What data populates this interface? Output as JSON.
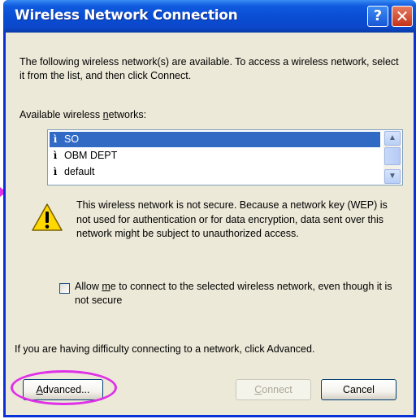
{
  "window": {
    "title": "Wireless Network Connection",
    "help_glyph": "?",
    "close_glyph": "✕"
  },
  "intro_text": "The following wireless network(s) are available. To access a wireless network, select it from the list, and then click Connect.",
  "available_label_pre": "Available wireless ",
  "available_label_mnemonic": "n",
  "available_label_post": "etworks:",
  "networks": [
    {
      "name": "SO",
      "selected": true
    },
    {
      "name": "OBM DEPT",
      "selected": false
    },
    {
      "name": "default",
      "selected": false
    }
  ],
  "network_icon_glyph": "ì",
  "scroll_up_glyph": "▲",
  "scroll_down_glyph": "▼",
  "warning_text": "This wireless network is not secure. Because a network key (WEP) is not used for authentication or for data encryption, data sent over this network might be subject to unauthorized access.",
  "checkbox_text_pre": "Allow ",
  "checkbox_text_mnemonic": "m",
  "checkbox_text_post": "e to connect to the selected wireless network, even though it is not secure",
  "help_text": "If you are having difficulty connecting to a network, click Advanced.",
  "buttons": {
    "advanced_mnemonic": "A",
    "advanced_rest": "dvanced...",
    "connect_mnemonic": "C",
    "connect_rest": "onnect",
    "cancel": "Cancel"
  },
  "colors": {
    "titlebar": "#0a4ed4",
    "selection": "#316ac5",
    "annotation": "#e030e8",
    "dialog_bg": "#ece9d8"
  }
}
